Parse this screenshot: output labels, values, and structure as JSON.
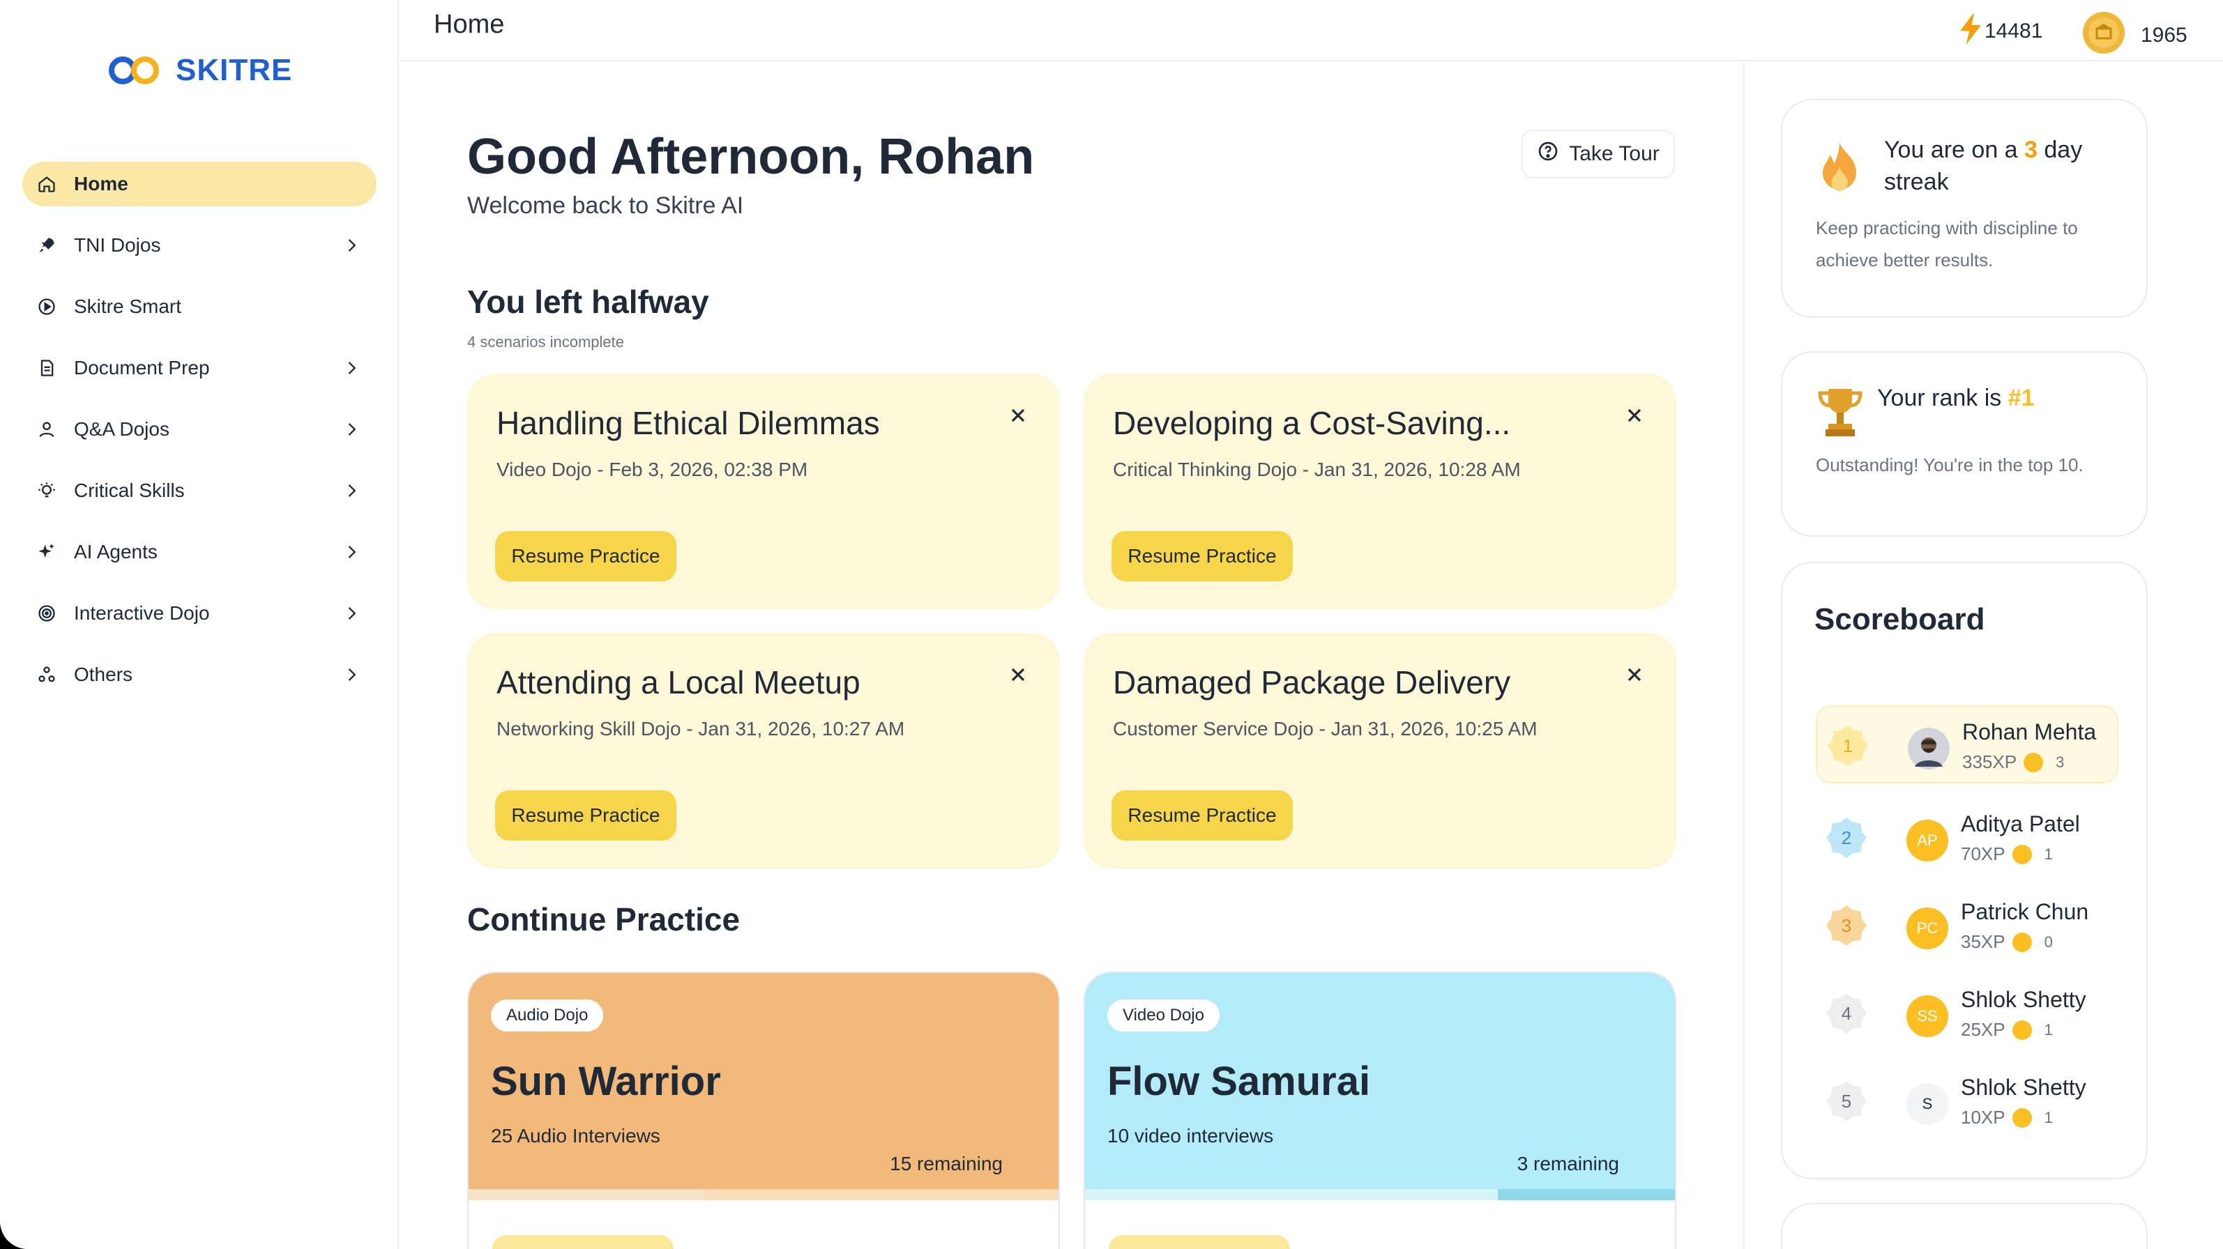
{
  "app": {
    "brand": "SKITRE"
  },
  "header": {
    "title": "Home",
    "xp": "14481",
    "coins": "1965"
  },
  "sidebar": {
    "items": [
      {
        "label": "Home",
        "icon": "home-icon",
        "active": true,
        "chevron": false
      },
      {
        "label": "TNI Dojos",
        "icon": "rocket-icon",
        "active": false,
        "chevron": true
      },
      {
        "label": "Skitre Smart",
        "icon": "play-circle-icon",
        "active": false,
        "chevron": false
      },
      {
        "label": "Document Prep",
        "icon": "document-icon",
        "active": false,
        "chevron": true
      },
      {
        "label": "Q&A Dojos",
        "icon": "user-icon",
        "active": false,
        "chevron": true
      },
      {
        "label": "Critical Skills",
        "icon": "lightbulb-icon",
        "active": false,
        "chevron": true
      },
      {
        "label": "AI Agents",
        "icon": "sparkle-icon",
        "active": false,
        "chevron": true
      },
      {
        "label": "Interactive Dojo",
        "icon": "target-icon",
        "active": false,
        "chevron": true
      },
      {
        "label": "Others",
        "icon": "nodes-icon",
        "active": false,
        "chevron": true
      }
    ]
  },
  "main": {
    "greeting": "Good Afternoon, Rohan",
    "welcome": "Welcome back to Skitre AI",
    "tour_label": "Take Tour",
    "halfway": {
      "title": "You left halfway",
      "subtitle": "4 scenarios incomplete",
      "cards": [
        {
          "title": "Handling Ethical Dilemmas",
          "meta": "Video Dojo - Feb 3, 2026, 02:38 PM",
          "button": "Resume Practice"
        },
        {
          "title": "Developing a Cost-Saving...",
          "meta": "Critical Thinking Dojo - Jan 31, 2026, 10:28 AM",
          "button": "Resume Practice"
        },
        {
          "title": "Attending a Local Meetup",
          "meta": "Networking Skill Dojo - Jan 31, 2026, 10:27 AM",
          "button": "Resume Practice"
        },
        {
          "title": "Damaged Package Delivery",
          "meta": "Customer Service Dojo - Jan 31, 2026, 10:25 AM",
          "button": "Resume Practice"
        }
      ]
    },
    "continue": {
      "title": "Continue Practice",
      "cards": [
        {
          "badge": "Audio Dojo",
          "title": "Sun Warrior",
          "count": "25 Audio Interviews",
          "remaining": "15 remaining",
          "progress": 0.4,
          "color": "#f2b97a",
          "bar_bg": "#f9dcb8",
          "bar_fill": "#f7e3c9"
        },
        {
          "badge": "Video Dojo",
          "title": "Flow Samurai",
          "count": "10 video interviews",
          "remaining": "3 remaining",
          "progress": 0.7,
          "color": "#b3ebf8",
          "bar_bg": "#8fd8ea",
          "bar_fill": "#d8f4fb"
        }
      ]
    }
  },
  "right": {
    "streak": {
      "prefix": "You are on a ",
      "days": "3",
      "suffix": " day streak",
      "desc": "Keep practicing with discipline to achieve better results."
    },
    "rank": {
      "prefix": "Your rank is ",
      "rank": "#1",
      "desc": "Outstanding! You're in the top 10."
    },
    "scoreboard": {
      "title": "Scoreboard",
      "rows": [
        {
          "rank": "1",
          "initials": "",
          "name": "Rohan Mehta",
          "xp": "335XP",
          "coins": "3",
          "photo": true
        },
        {
          "rank": "2",
          "initials": "AP",
          "name": "Aditya Patel",
          "xp": "70XP",
          "coins": "1",
          "photo": false
        },
        {
          "rank": "3",
          "initials": "PC",
          "name": "Patrick Chun",
          "xp": "35XP",
          "coins": "0",
          "photo": false
        },
        {
          "rank": "4",
          "initials": "SS",
          "name": "Shlok Shetty",
          "xp": "25XP",
          "coins": "1",
          "photo": false
        },
        {
          "rank": "5",
          "initials": "S",
          "name": "Shlok Shetty",
          "xp": "10XP",
          "coins": "1",
          "photo": false
        }
      ]
    }
  },
  "colors": {
    "accent": "#f7d54a",
    "active_nav": "#fce8a6",
    "card_bg": "#fef7d8",
    "brand": "#1f5fcf"
  }
}
